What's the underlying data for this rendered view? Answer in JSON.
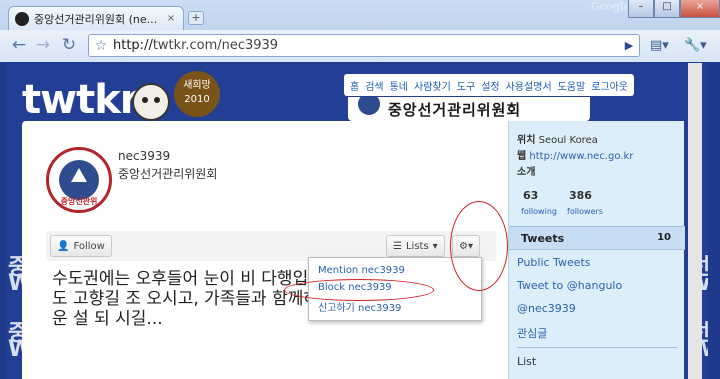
{
  "browser": {
    "tab_title": "중앙선거관리위원회 (ne...",
    "tab_close": "×",
    "new_tab": "+",
    "brand": "Google",
    "window_controls": [
      "–",
      "□",
      "×"
    ],
    "back": "←",
    "forward": "→",
    "reload": "↻",
    "star": "☆",
    "url_prefix": "http://",
    "url_host": "twtkr.com/nec3939",
    "go": "▶",
    "page_menu": "▤▾",
    "wrench": "🔧▾"
  },
  "site": {
    "logo": "twtkr",
    "badge_line1": "새희망",
    "badge_line2": "2010",
    "menu": [
      "홈",
      "검색",
      "통네",
      "사람찾기",
      "도구",
      "설정",
      "사용설명서",
      "도움말",
      "로그아웃"
    ],
    "banner_text": "중앙선거관리위원회"
  },
  "profile": {
    "avatar_text": "중앙선관위",
    "username": "nec3939",
    "fullname": "중앙선거관리위원회",
    "follow_label": "Follow",
    "lists_label": "Lists",
    "lists_arrow": "▾",
    "gear_label": "⚙▾"
  },
  "dropdown": {
    "items": [
      "Mention nec3939",
      "Block nec3939",
      "신고하기 nec3939"
    ]
  },
  "tweet": {
    "text": "수도권에는 오후들어 눈이 비 다행입니다. 그래도 고향길 조 오시고, 가족들과 함께하는 즐거운 설 되 시길..."
  },
  "sidebar": {
    "location_label": "위치",
    "location_value": "Seoul Korea",
    "web_label": "웹",
    "web_value": "http://www.nec.go.kr",
    "bio_label": "소개",
    "following_count": "63",
    "following_label": "following",
    "followers_count": "386",
    "followers_label": "followers",
    "tweets_label": "Tweets",
    "tweets_count": "10",
    "links": [
      "Public Tweets",
      "Tweet to @hangulo",
      "@nec3939",
      "관심글"
    ],
    "list_label": "List"
  },
  "background_text": [
    "중",
    "W",
    "중",
    "W",
    "선",
    "w",
    "선",
    "W"
  ],
  "colors": {
    "page_bg": "#233f95",
    "link": "#2a62b0",
    "annotation": "#d02020"
  }
}
